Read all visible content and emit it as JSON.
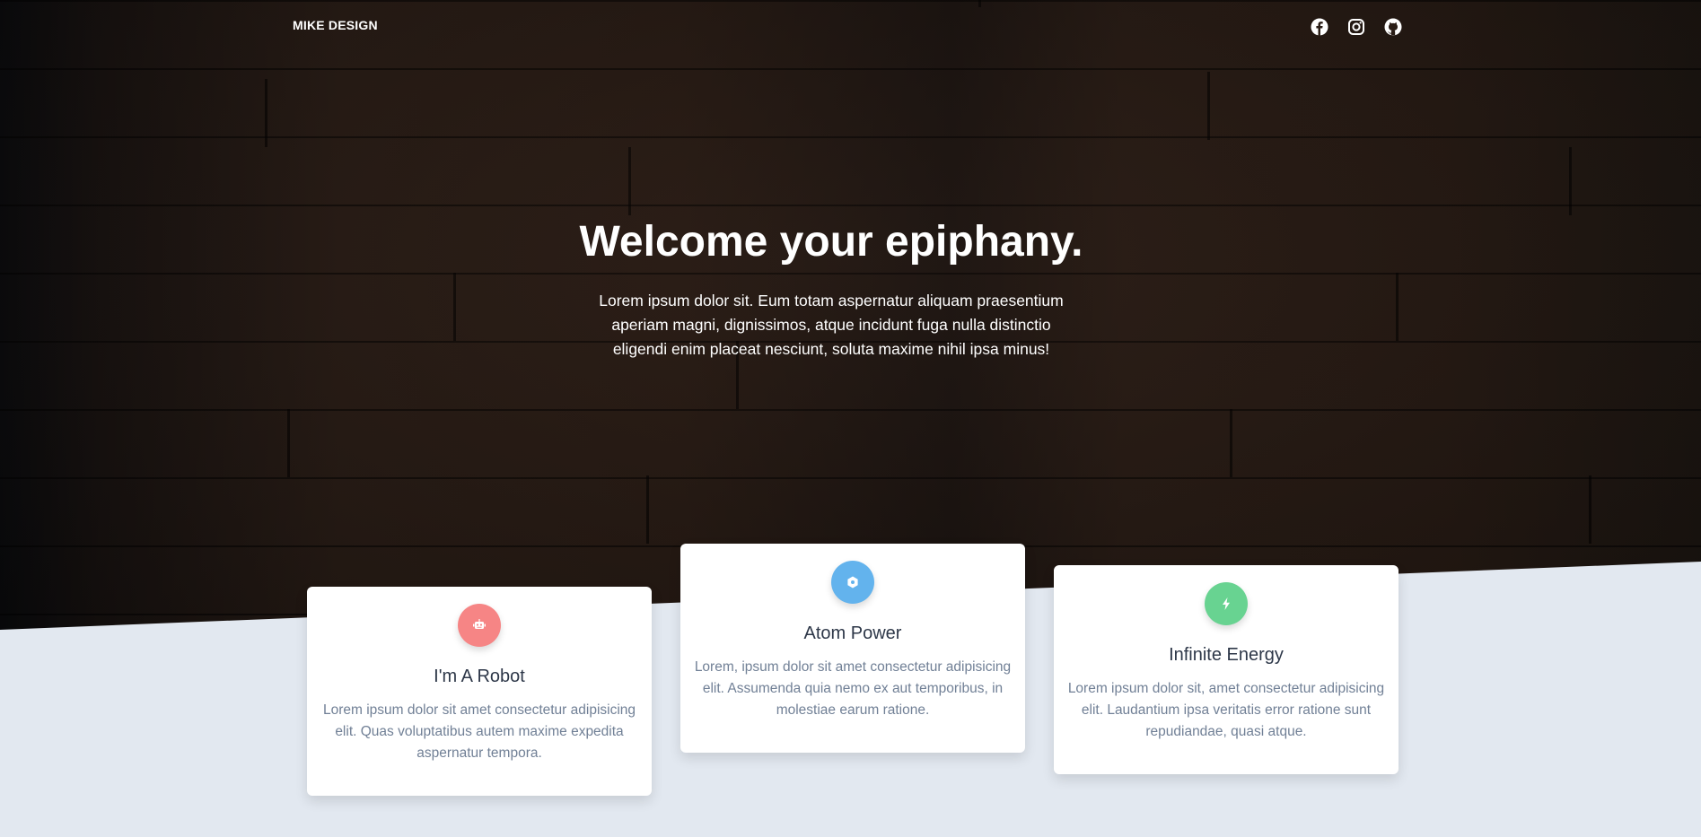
{
  "nav": {
    "brand": "MIKE DESIGN",
    "social_icons": [
      "facebook-icon",
      "instagram-icon",
      "github-icon"
    ]
  },
  "hero": {
    "title": "Welcome your epiphany.",
    "subtitle": "Lorem ipsum dolor sit. Eum totam aspernatur aliquam praesentium aperiam magni, dignissimos, atque incidunt fuga nulla distinctio eligendi enim placeat nesciunt, soluta maxime nihil ipsa minus!"
  },
  "cards": [
    {
      "icon": "robot-icon",
      "color": "#f68585",
      "title": "I'm A Robot",
      "text": "Lorem ipsum dolor sit amet consectetur adipisicing elit. Quas voluptatibus autem maxime expedita aspernatur tempora."
    },
    {
      "icon": "atom-icon",
      "color": "#63b3ed",
      "title": "Atom Power",
      "text": "Lorem, ipsum dolor sit amet consectetur adipisicing elit. Assumenda quia nemo ex aut temporibus, in molestiae earum ratione."
    },
    {
      "icon": "lightning-icon",
      "color": "#68d391",
      "title": "Infinite Energy",
      "text": "Lorem ipsum dolor sit, amet consectetur adipisicing elit. Laudantium ipsa veritatis error ratione sunt repudiandae, quasi atque."
    }
  ]
}
